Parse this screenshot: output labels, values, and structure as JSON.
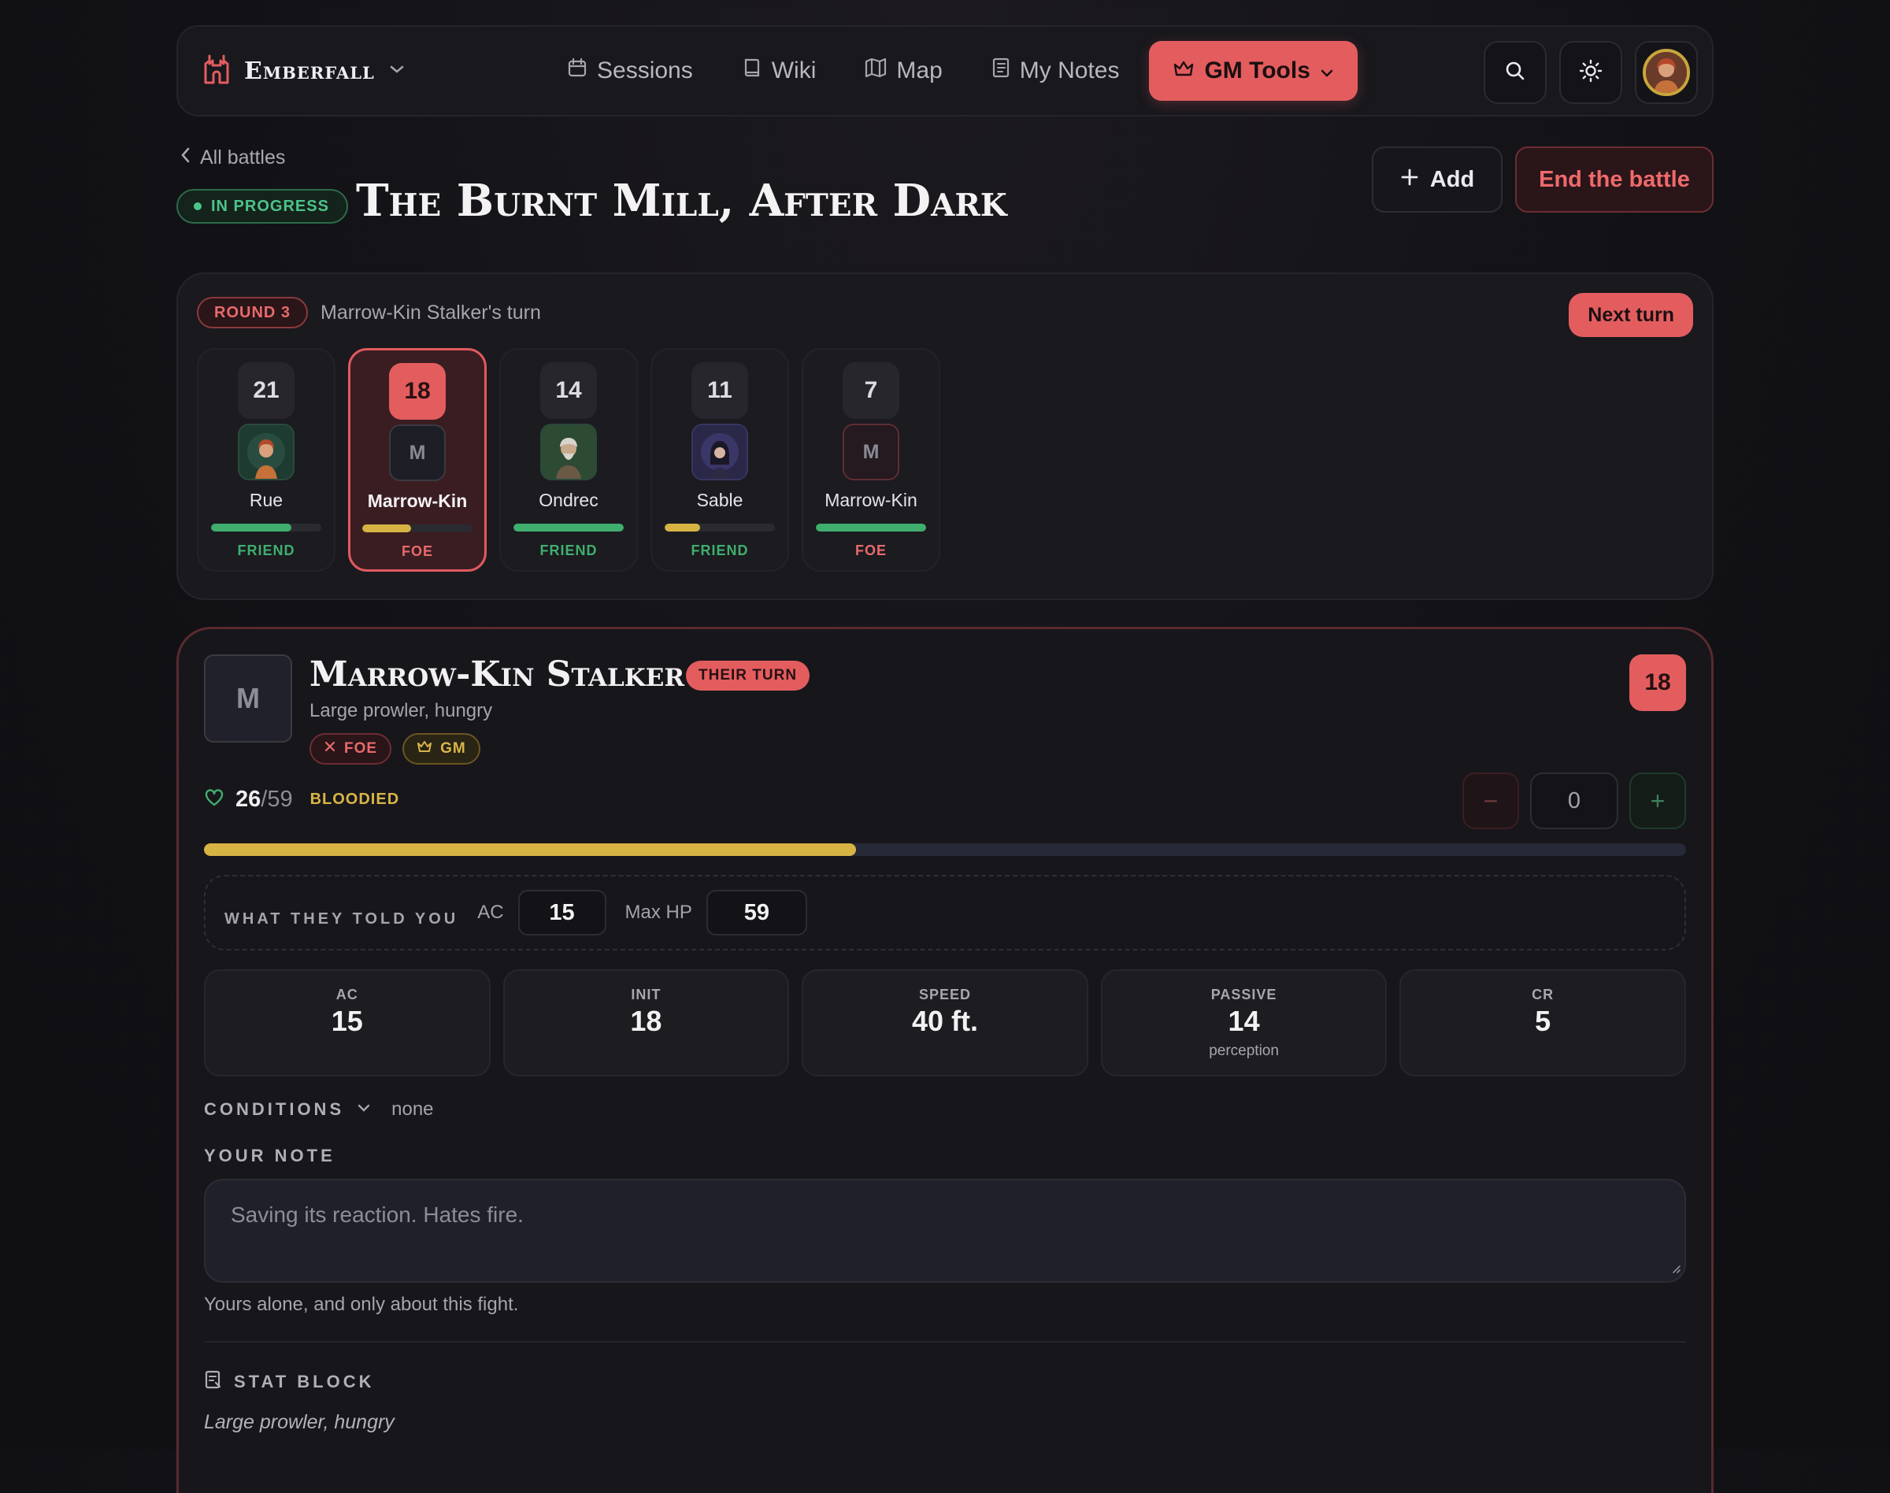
{
  "nav": {
    "brand": "Emberfall",
    "links": [
      {
        "label": "Sessions",
        "icon": "calendar-icon"
      },
      {
        "label": "Wiki",
        "icon": "book-icon"
      },
      {
        "label": "Map",
        "icon": "map-icon"
      },
      {
        "label": "My Notes",
        "icon": "notebook-icon"
      }
    ],
    "gm_tools": "GM Tools",
    "accent": "#e35d5f"
  },
  "header": {
    "back": "All battles",
    "status": "IN PROGRESS",
    "title": "The Burnt Mill, After Dark",
    "add": "Add",
    "end": "End the battle"
  },
  "tracker": {
    "round": "ROUND 3",
    "turn_text": "Marrow-Kin Stalker's turn",
    "next_turn": "Next turn",
    "combatants": [
      {
        "init": "21",
        "name": "Rue",
        "side": "FRIEND",
        "hp_fraction": 0.73,
        "bar_color": "#3fae6e",
        "portrait": "rue-portrait"
      },
      {
        "init": "18",
        "name": "Marrow-Kin",
        "side": "FOE",
        "hp_fraction": 0.44,
        "bar_color": "#d6b343",
        "portrait": "M",
        "active": true
      },
      {
        "init": "14",
        "name": "Ondrec",
        "side": "FRIEND",
        "hp_fraction": 1.0,
        "bar_color": "#3fae6e",
        "portrait": "ondrec-portrait"
      },
      {
        "init": "11",
        "name": "Sable",
        "side": "FRIEND",
        "hp_fraction": 0.32,
        "bar_color": "#d6b343",
        "portrait": "sable-portrait"
      },
      {
        "init": "7",
        "name": "Marrow-Kin",
        "side": "FOE",
        "hp_fraction": 1.0,
        "bar_color": "#3fae6e",
        "portrait": "M"
      }
    ]
  },
  "detail": {
    "initial": "M",
    "name": "Marrow-Kin Stalker",
    "their_turn": "THEIR TURN",
    "subtitle": "Large prowler, hungry",
    "tag_foe": "FOE",
    "tag_gm": "GM",
    "init": "18",
    "hp_current": "26",
    "hp_max": "/59",
    "hp_fraction": 0.44,
    "hp_state": "BLOODIED",
    "hp_delta": "0",
    "minus": "−",
    "plus": "+",
    "told_label": "WHAT THEY TOLD YOU",
    "told_ac_label": "AC",
    "told_ac": "15",
    "told_maxhp_label": "Max HP",
    "told_maxhp": "59",
    "stats": [
      {
        "key": "AC",
        "value": "15",
        "sub": ""
      },
      {
        "key": "INIT",
        "value": "18",
        "sub": ""
      },
      {
        "key": "SPEED",
        "value": "40 ft.",
        "sub": ""
      },
      {
        "key": "PASSIVE",
        "value": "14",
        "sub": "perception"
      },
      {
        "key": "CR",
        "value": "5",
        "sub": ""
      }
    ],
    "conditions_label": "CONDITIONS",
    "conditions_value": "none",
    "note_label": "YOUR NOTE",
    "note_placeholder": "Saving its reaction. Hates fire.",
    "note_help": "Yours alone, and only about this fight.",
    "statblock_label": "STAT BLOCK",
    "statblock_sub": "Large prowler, hungry"
  }
}
